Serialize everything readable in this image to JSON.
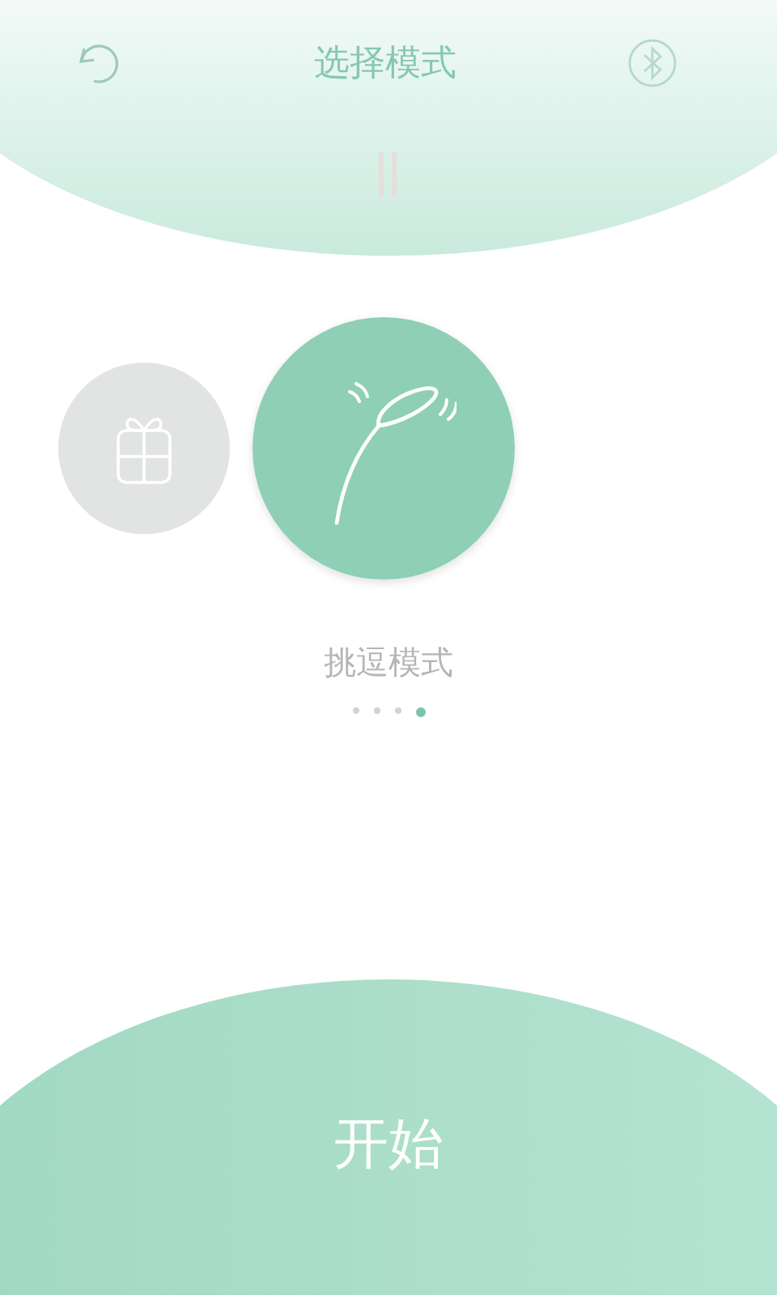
{
  "header": {
    "title": "选择模式"
  },
  "modes": [
    {
      "kind": "gift",
      "selected": false
    },
    {
      "kind": "teaser",
      "selected": true
    }
  ],
  "mode_label": "挑逗模式",
  "pager": [
    {
      "selected": false
    },
    {
      "selected": false
    },
    {
      "selected": false
    },
    {
      "selected": true
    }
  ],
  "start_button": "开始"
}
